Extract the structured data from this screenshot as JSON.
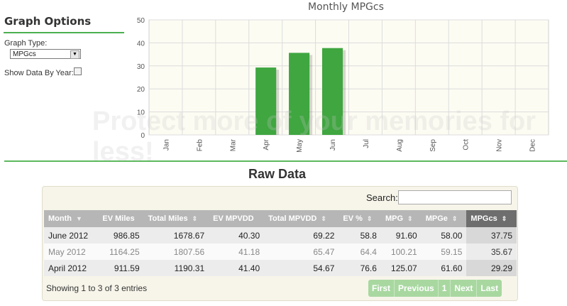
{
  "sidebar": {
    "title": "Graph Options",
    "graph_type_label": "Graph Type:",
    "graph_type_value": "MPGcs",
    "show_by_year_label": "Show Data By Year:"
  },
  "chart_data": {
    "type": "bar",
    "title": "Monthly MPGcs",
    "categories": [
      "Jan",
      "Feb",
      "Mar",
      "Apr",
      "May",
      "Jun",
      "Jul",
      "Aug",
      "Sep",
      "Oct",
      "Nov",
      "Dec"
    ],
    "values": [
      null,
      null,
      null,
      29.29,
      35.67,
      37.75,
      null,
      null,
      null,
      null,
      null,
      null
    ],
    "ylim": [
      0,
      50
    ],
    "yticks": [
      0,
      10,
      20,
      30,
      40,
      50
    ],
    "bar_color": "#3fa640",
    "grid": true
  },
  "raw_title": "Raw Data",
  "search": {
    "label": "Search:",
    "value": ""
  },
  "table": {
    "columns": [
      "Month",
      "EV Miles",
      "Total Miles",
      "EV MPVDD",
      "Total MPVDD",
      "EV %",
      "MPG",
      "MPGe",
      "MPGcs"
    ],
    "rows": [
      [
        "June 2012",
        "986.85",
        "1678.67",
        "40.30",
        "69.22",
        "58.8",
        "91.60",
        "58.00",
        "37.75"
      ],
      [
        "May 2012",
        "1164.25",
        "1807.56",
        "41.18",
        "65.47",
        "64.4",
        "100.21",
        "59.15",
        "35.67"
      ],
      [
        "April 2012",
        "911.59",
        "1190.31",
        "41.40",
        "54.67",
        "76.6",
        "125.07",
        "61.60",
        "29.29"
      ]
    ]
  },
  "info": "Showing 1 to 3 of 3 entries",
  "pager": {
    "first": "First",
    "previous": "Previous",
    "page": "1",
    "next": "Next",
    "last": "Last"
  },
  "watermark": "Protect more of your memories for less!"
}
